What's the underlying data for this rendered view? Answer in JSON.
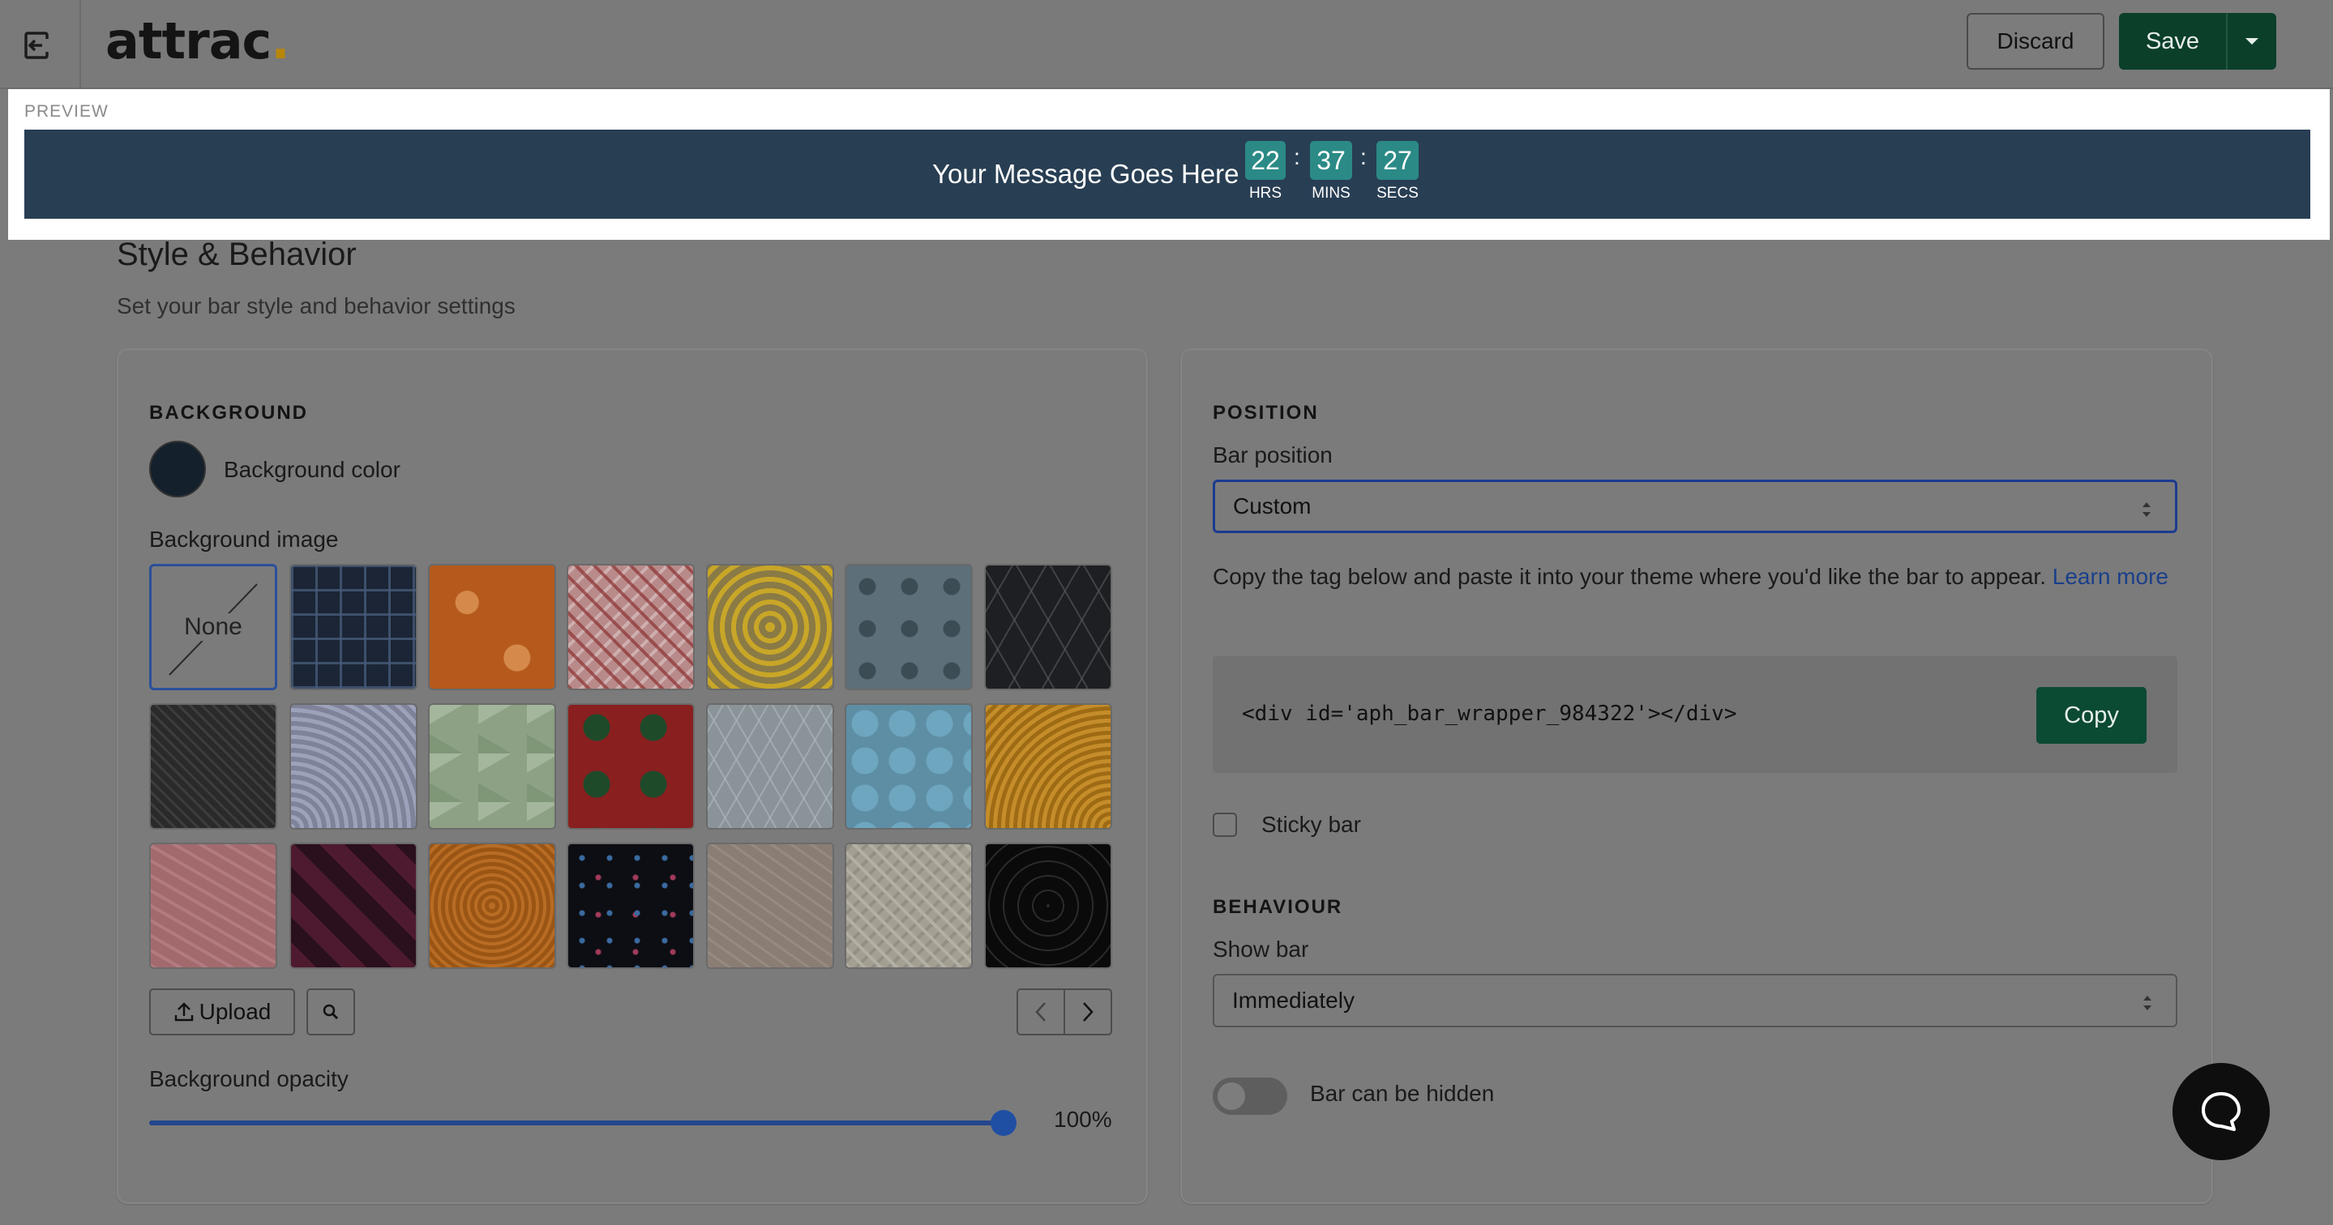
{
  "header": {
    "logo_text": "attrac",
    "logo_dot": ".",
    "discard_label": "Discard",
    "save_label": "Save"
  },
  "preview": {
    "label": "PREVIEW",
    "message": "Your Message Goes Here",
    "countdown": {
      "hours": "22",
      "hours_label": "HRS",
      "minutes": "37",
      "minutes_label": "MINS",
      "seconds": "27",
      "seconds_label": "SECS",
      "separator": ":"
    },
    "bar_color": "#283e53",
    "digit_color": "#2b8a86"
  },
  "section": {
    "title": "Style & Behavior",
    "subtitle": "Set your bar style and behavior settings"
  },
  "background": {
    "heading": "BACKGROUND",
    "color_label": "Background color",
    "color_value": "#14202c",
    "image_label": "Background image",
    "none_label": "None",
    "upload_label": "Upload",
    "opacity_label": "Background opacity",
    "opacity_value": "100%",
    "opacity_fraction": 1.0,
    "patterns": [
      "none",
      "dark-navy-geometric",
      "orange-halloween",
      "red-bones",
      "yellow-waves",
      "blue-baskets",
      "black-triangles",
      "charcoal-stripes",
      "lavender-circles",
      "green-cubes",
      "red-christmas-trees",
      "grey-trees",
      "blue-hexagons",
      "orange-swirls",
      "pink-waves",
      "burgundy-stripes",
      "orange-rings",
      "black-confetti",
      "tan-waves",
      "beige-weave",
      "black-circles"
    ]
  },
  "position": {
    "heading": "POSITION",
    "bar_position_label": "Bar position",
    "bar_position_value": "Custom",
    "description": "Copy the tag below and paste it into your theme where you'd like the bar to appear.",
    "learn_more": "Learn more",
    "code": "<div id='aph_bar_wrapper_984322'></div>",
    "copy_label": "Copy",
    "sticky_label": "Sticky bar"
  },
  "behaviour": {
    "heading": "BEHAVIOUR",
    "show_bar_label": "Show bar",
    "show_bar_value": "Immediately",
    "hidden_label": "Bar can be hidden"
  },
  "icons": {
    "exit": "exit-icon",
    "chevron": "chevron-down-icon",
    "upload": "upload-icon",
    "search": "search-icon",
    "prev": "chevron-left-icon",
    "next": "chevron-right-icon",
    "help": "chat-bubble-icon"
  }
}
